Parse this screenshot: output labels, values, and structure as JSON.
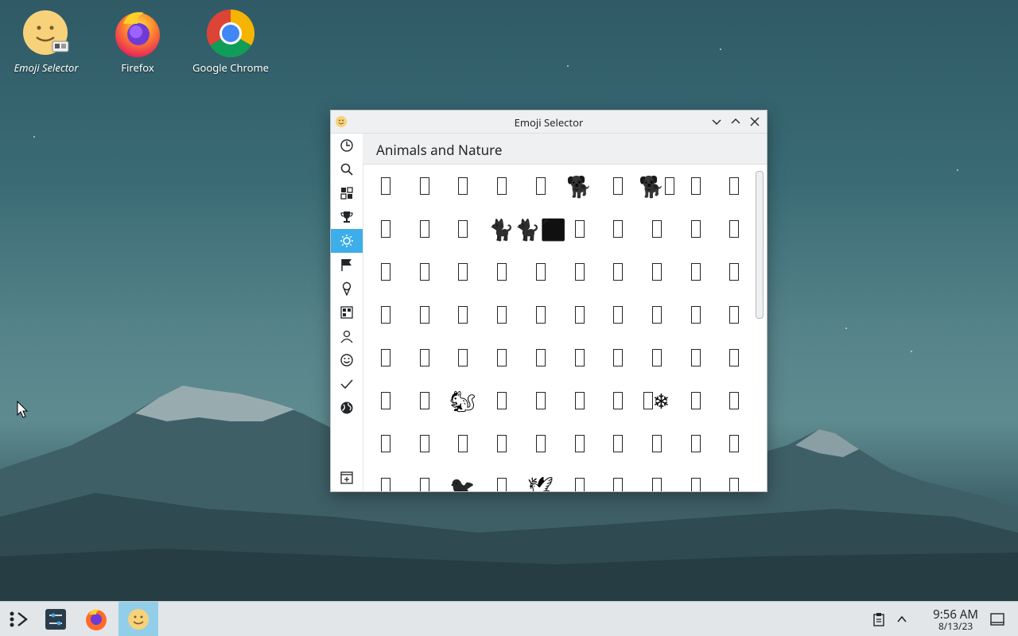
{
  "desktop": {
    "icons": [
      {
        "label": "Emoji Selector",
        "icon": "emoji-selector-icon"
      },
      {
        "label": "Firefox",
        "icon": "firefox-icon"
      },
      {
        "label": "Google Chrome",
        "icon": "chrome-icon"
      }
    ]
  },
  "window": {
    "title": "Emoji Selector",
    "category_title": "Animals and Nature",
    "sidebar": [
      {
        "name": "recent",
        "icon": "clock-icon"
      },
      {
        "name": "search",
        "icon": "search-icon"
      },
      {
        "name": "all",
        "icon": "grid-icon"
      },
      {
        "name": "activities",
        "icon": "trophy-icon"
      },
      {
        "name": "animals-and-nature",
        "icon": "sun-icon",
        "active": true
      },
      {
        "name": "flags",
        "icon": "flag-icon"
      },
      {
        "name": "food-and-drink",
        "icon": "ice-cream-icon"
      },
      {
        "name": "objects",
        "icon": "objects-icon"
      },
      {
        "name": "people-and-body",
        "icon": "person-icon"
      },
      {
        "name": "smileys-and-emotion",
        "icon": "smiley-icon"
      },
      {
        "name": "symbols",
        "icon": "check-icon"
      },
      {
        "name": "travel-and-places",
        "icon": "globe-icon"
      }
    ],
    "grid": [
      [
        "□",
        "□",
        "□",
        "□",
        "□",
        "🐕",
        "□",
        "🐕□",
        "□",
        "□"
      ],
      [
        "□",
        "□",
        "□",
        "🐈",
        "🐈⬛",
        "□",
        "□",
        "□",
        "□",
        "□"
      ],
      [
        "□",
        "□",
        "□",
        "□",
        "□",
        "□",
        "□",
        "□",
        "□",
        "□"
      ],
      [
        "□",
        "□",
        "□",
        "□",
        "□",
        "□",
        "□",
        "□",
        "□",
        "□"
      ],
      [
        "□",
        "□",
        "□",
        "□",
        "□",
        "□",
        "□",
        "□",
        "□",
        "□"
      ],
      [
        "□",
        "□",
        "🐿",
        "□",
        "□",
        "□",
        "□",
        "□❄",
        "□",
        "□"
      ],
      [
        "□",
        "□",
        "□",
        "□",
        "□",
        "□",
        "□",
        "□",
        "□",
        "□"
      ],
      [
        "□",
        "□",
        "🐦",
        "□",
        "🕊",
        "□",
        "□",
        "□",
        "□",
        "□"
      ]
    ]
  },
  "taskbar": {
    "time": "9:56 AM",
    "date": "8/13/23"
  }
}
